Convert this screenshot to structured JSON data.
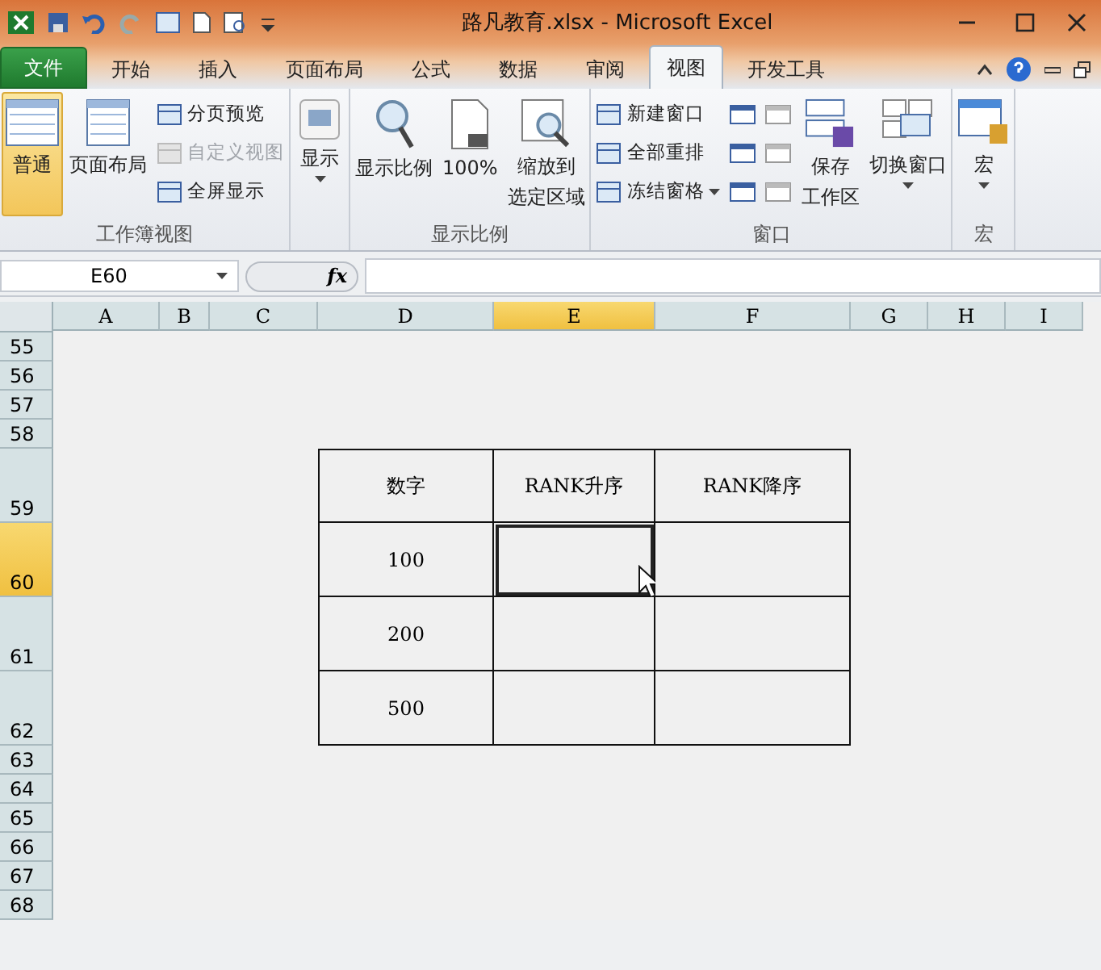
{
  "window": {
    "title": "路凡教育.xlsx - Microsoft Excel"
  },
  "file_tab": {
    "label": "文件"
  },
  "tabs": [
    {
      "label": "开始",
      "selected": false
    },
    {
      "label": "插入",
      "selected": false
    },
    {
      "label": "页面布局",
      "selected": false
    },
    {
      "label": "公式",
      "selected": false
    },
    {
      "label": "数据",
      "selected": false
    },
    {
      "label": "审阅",
      "selected": false
    },
    {
      "label": "视图",
      "selected": true
    },
    {
      "label": "开发工具",
      "selected": false
    }
  ],
  "ribbon": [
    {
      "label": "工作簿视图",
      "buttons": [
        {
          "kind": "large",
          "lines": [
            "普通"
          ],
          "selected": true
        },
        {
          "kind": "large",
          "lines": [
            "页面布局"
          ],
          "selected": false
        },
        {
          "kind": "small",
          "lines": [
            "分页预览"
          ],
          "disabled": false
        },
        {
          "kind": "small",
          "lines": [
            "自定义视图"
          ],
          "disabled": true
        },
        {
          "kind": "small",
          "lines": [
            "全屏显示"
          ],
          "disabled": false
        }
      ]
    },
    {
      "buttons": [
        {
          "kind": "large",
          "lines": [
            "显示"
          ],
          "selected": false,
          "dropdown": true
        }
      ]
    },
    {
      "label": "显示比例",
      "buttons": [
        {
          "kind": "large",
          "lines": [
            "显示比例"
          ],
          "selected": false
        },
        {
          "kind": "large",
          "lines": [
            "100%"
          ],
          "selected": false
        },
        {
          "kind": "large",
          "lines": [
            "缩放到",
            "选定区域"
          ],
          "selected": false
        }
      ]
    },
    {
      "label": "窗口",
      "buttons": [
        {
          "kind": "small",
          "lines": [
            "新建窗口"
          ],
          "disabled": false
        },
        {
          "kind": "small",
          "lines": [
            "全部重排"
          ],
          "disabled": false
        },
        {
          "kind": "small",
          "lines": [
            "冻结窗格"
          ],
          "disabled": false,
          "dropdown": true
        },
        {
          "kind": "iconcol"
        },
        {
          "kind": "large",
          "lines": [
            "保存",
            "工作区"
          ],
          "selected": false
        },
        {
          "kind": "large",
          "lines": [
            "切换窗口"
          ],
          "selected": false,
          "dropdown": true
        }
      ]
    },
    {
      "label": "宏",
      "buttons": [
        {
          "kind": "large",
          "lines": [
            "宏"
          ],
          "selected": false,
          "dropdown": true
        }
      ]
    }
  ],
  "formula_bar": {
    "name_box": "E60",
    "function_label": "fx"
  },
  "columns": [
    {
      "label": "A",
      "selected": false
    },
    {
      "label": "B",
      "selected": false
    },
    {
      "label": "C",
      "selected": false
    },
    {
      "label": "D",
      "selected": false
    },
    {
      "label": "E",
      "selected": true
    },
    {
      "label": "F",
      "selected": false
    },
    {
      "label": "G",
      "selected": false
    },
    {
      "label": "H",
      "selected": false
    },
    {
      "label": "I",
      "selected": false
    }
  ],
  "rows": [
    {
      "label": "55",
      "tall": false,
      "selected": false
    },
    {
      "label": "56",
      "tall": false,
      "selected": false
    },
    {
      "label": "57",
      "tall": false,
      "selected": false
    },
    {
      "label": "58",
      "tall": false,
      "selected": false
    },
    {
      "label": "59",
      "tall": true,
      "selected": false,
      "cells": [
        {
          "text": "数字",
          "selected": false
        },
        {
          "text": "RANK升序",
          "selected": false
        },
        {
          "text": "RANK降序",
          "selected": false
        }
      ]
    },
    {
      "label": "60",
      "tall": true,
      "selected": true,
      "cells": [
        {
          "text": "100",
          "selected": false
        },
        {
          "selected": true
        },
        {
          "selected": false
        }
      ]
    },
    {
      "label": "61",
      "tall": true,
      "selected": false,
      "cells": [
        {
          "text": "200",
          "selected": false
        },
        {
          "selected": false
        },
        {
          "selected": false
        }
      ]
    },
    {
      "label": "62",
      "tall": true,
      "selected": false,
      "cells": [
        {
          "text": "500",
          "selected": false
        },
        {
          "selected": false
        },
        {
          "selected": false
        }
      ]
    },
    {
      "label": "63",
      "tall": false,
      "selected": false
    },
    {
      "label": "64",
      "tall": false,
      "selected": false
    },
    {
      "label": "65",
      "tall": false,
      "selected": false
    },
    {
      "label": "66",
      "tall": false,
      "selected": false
    },
    {
      "label": "67",
      "tall": false,
      "selected": false
    },
    {
      "label": "68",
      "tall": false,
      "selected": false
    }
  ]
}
